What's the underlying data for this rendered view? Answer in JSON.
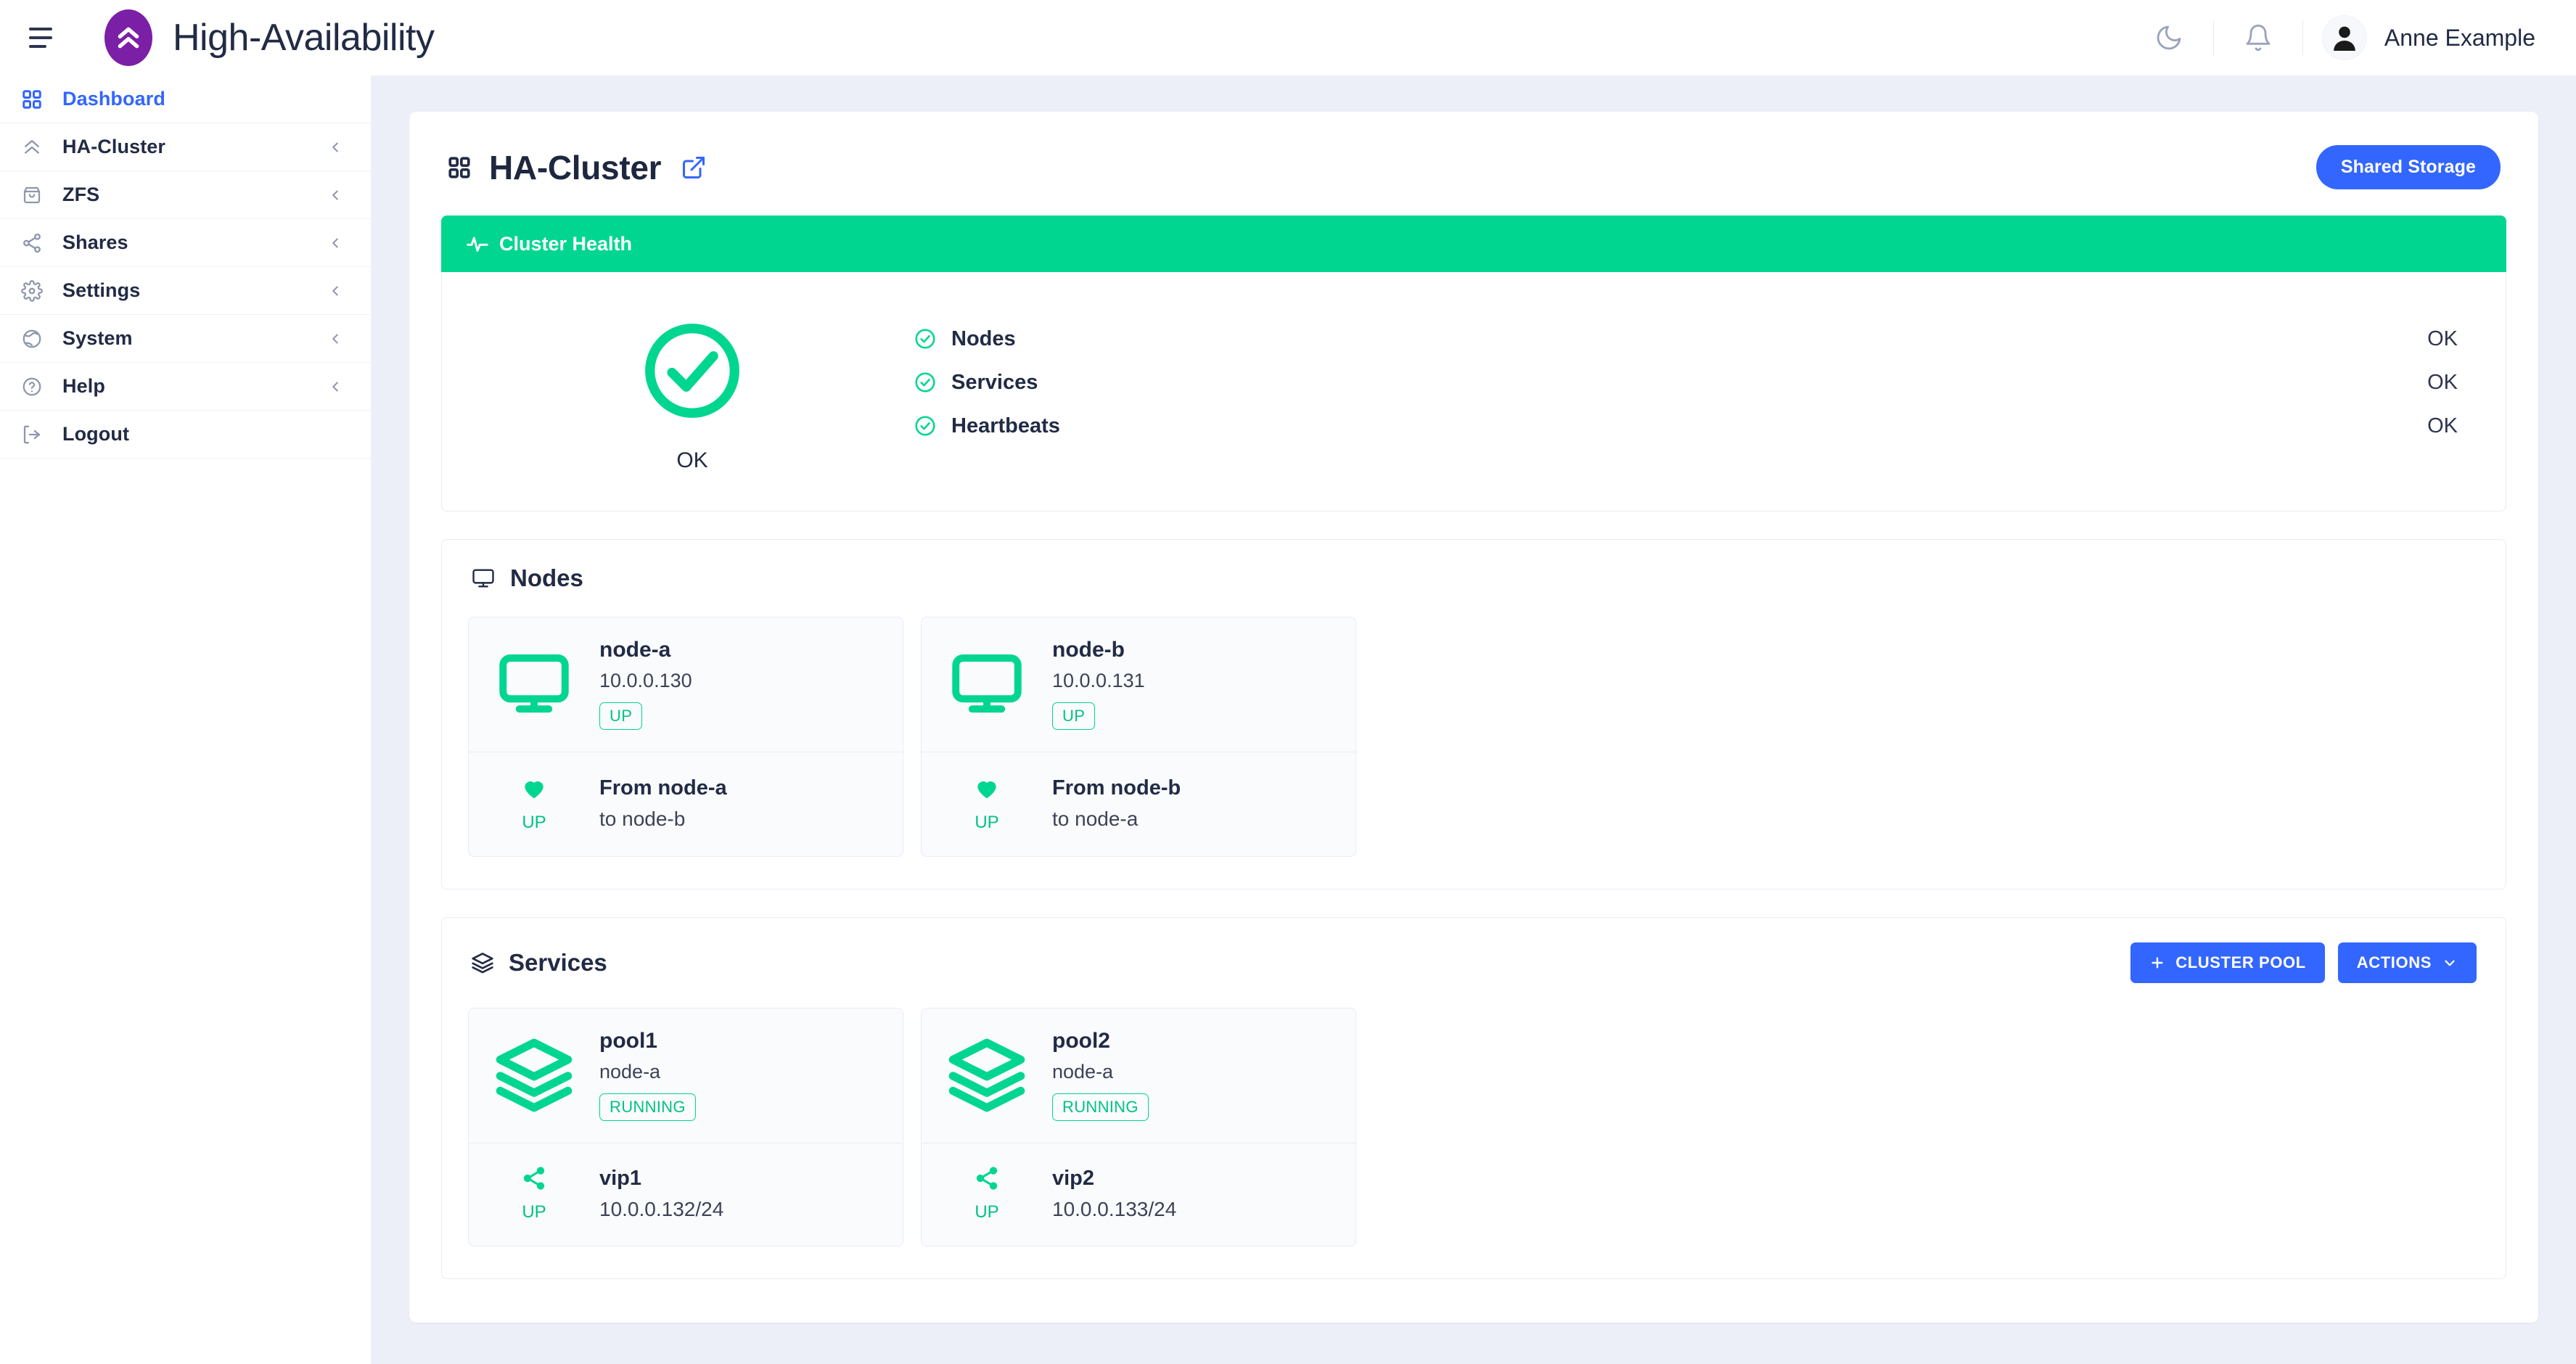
{
  "topbar": {
    "menu_icon": "hamburger-icon",
    "logo_icon": "double-chevron-up-logo",
    "brand_title": "High-Availability",
    "dark_mode_icon": "moon-icon",
    "notifications_icon": "bell-icon",
    "avatar_icon": "user-avatar-icon",
    "username": "Anne Example"
  },
  "sidebar": {
    "items": [
      {
        "label": "Dashboard",
        "icon": "grid-icon",
        "active": true,
        "chevron": false
      },
      {
        "label": "HA-Cluster",
        "icon": "double-chevron-up-icon",
        "active": false,
        "chevron": true
      },
      {
        "label": "ZFS",
        "icon": "archive-box-icon",
        "active": false,
        "chevron": true
      },
      {
        "label": "Shares",
        "icon": "share-icon",
        "active": false,
        "chevron": true
      },
      {
        "label": "Settings",
        "icon": "gear-icon",
        "active": false,
        "chevron": true
      },
      {
        "label": "System",
        "icon": "globe-icon",
        "active": false,
        "chevron": true
      },
      {
        "label": "Help",
        "icon": "question-circle-icon",
        "active": false,
        "chevron": true
      },
      {
        "label": "Logout",
        "icon": "logout-icon",
        "active": false,
        "chevron": false
      }
    ]
  },
  "page": {
    "title": "HA-Cluster",
    "title_icon": "grid-icon",
    "external_link_icon": "external-link-icon",
    "shared_storage_label": "Shared Storage"
  },
  "health": {
    "panel_title": "Cluster Health",
    "panel_icon": "activity-pulse-icon",
    "overall_icon": "check-circle-icon",
    "overall_status": "OK",
    "checks": [
      {
        "icon": "check-circle-icon",
        "name": "Nodes",
        "status": "OK"
      },
      {
        "icon": "check-circle-icon",
        "name": "Services",
        "status": "OK"
      },
      {
        "icon": "check-circle-icon",
        "name": "Heartbeats",
        "status": "OK"
      }
    ]
  },
  "nodes": {
    "title": "Nodes",
    "icon": "monitor-icon",
    "cards": [
      {
        "icon": "monitor-icon",
        "name": "node-a",
        "address": "10.0.0.130",
        "badge": "UP",
        "footer_icon": "heart-icon",
        "footer_status": "UP",
        "footer_title": "From node-a",
        "footer_sub": "to node-b"
      },
      {
        "icon": "monitor-icon",
        "name": "node-b",
        "address": "10.0.0.131",
        "badge": "UP",
        "footer_icon": "heart-icon",
        "footer_status": "UP",
        "footer_title": "From node-b",
        "footer_sub": "to node-a"
      }
    ]
  },
  "services": {
    "title": "Services",
    "icon": "layers-icon",
    "add_pool_label": "CLUSTER POOL",
    "add_pool_icon": "plus-icon",
    "actions_label": "ACTIONS",
    "actions_icon": "chevron-down-icon",
    "cards": [
      {
        "icon": "layers-icon",
        "name": "pool1",
        "host": "node-a",
        "badge": "RUNNING",
        "footer_icon": "share-icon",
        "footer_status": "UP",
        "footer_title": "vip1",
        "footer_sub": "10.0.0.132/24"
      },
      {
        "icon": "layers-icon",
        "name": "pool2",
        "host": "node-a",
        "badge": "RUNNING",
        "footer_icon": "share-icon",
        "footer_status": "UP",
        "footer_title": "vip2",
        "footer_sub": "10.0.0.133/24"
      }
    ]
  },
  "colors": {
    "accent_blue": "#3366ff",
    "success_green": "#00d68f",
    "brand_purple": "#7b1fa6",
    "text_dark": "#222b45",
    "page_bg": "#edeff8"
  }
}
